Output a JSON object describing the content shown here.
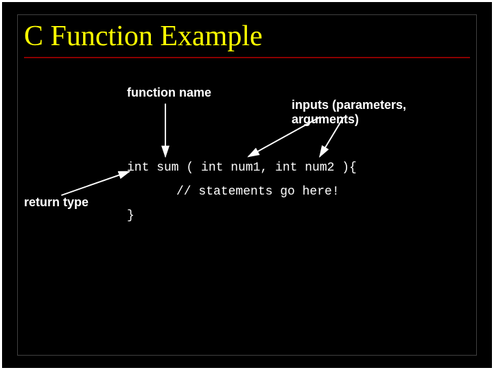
{
  "title": "C Function Example",
  "labels": {
    "function_name": "function name",
    "inputs": "inputs (parameters, arguments)",
    "return_type": "return type"
  },
  "code": {
    "signature": "int sum ( int num1, int num2 ){",
    "comment": "// statements go here!",
    "close": "}"
  }
}
